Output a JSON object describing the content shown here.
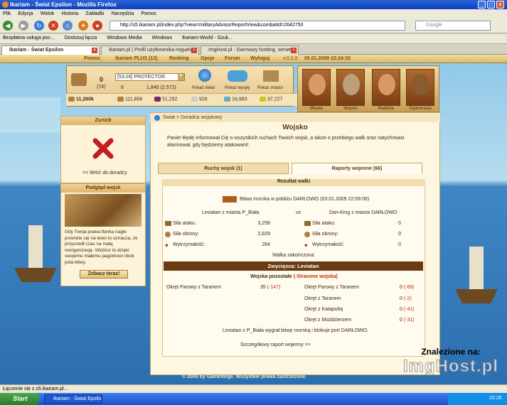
{
  "window": {
    "title": "Ikariam - Świat Epsilon - Mozilla Firefox"
  },
  "menu": [
    "Plik",
    "Edycja",
    "Widok",
    "Historia",
    "Zakładki",
    "Narzędzia",
    "Pomoc"
  ],
  "address": {
    "url": "http://s5.ikariam.pl/index.php?view=militaryAdvisorReportView&combatId=2642750",
    "search_placeholder": "Google"
  },
  "bookmarks": [
    "Bezpłatna usługa poc...",
    "Dostosuj łącza",
    "Windows Media",
    "Windows",
    "Ikariam-World - Szuk..."
  ],
  "tabs": [
    {
      "label": "Ikariam - Świat Epsilon",
      "active": true
    },
    {
      "label": "Ikariam.pl | Profil użytkownika miguela...",
      "active": false
    },
    {
      "label": "ImgHost.pl - Darmowy hosting, serwe...",
      "active": false
    }
  ],
  "game_nav": {
    "items": [
      "Pomoc",
      "Ikariam PLUS (13)",
      "Ranking",
      "Opcje",
      "Forum",
      "Wyloguj"
    ],
    "version": "v.0.2.8",
    "datetime": "05.01.2009 22:24:33"
  },
  "hud": {
    "citizens": "0",
    "citizens_sub": "(74)",
    "gold": "11,260k",
    "city_select": "[53:26] PROTECTOR",
    "actions": "6",
    "income": "1,845 (2,572)",
    "buttons": [
      "Pokaż świat",
      "Pokaż wyspę",
      "Pokaż miasto"
    ]
  },
  "resources": [
    "111,856",
    "51,292",
    "926",
    "16,983",
    "37,227"
  ],
  "advisors": [
    "Miasta",
    "Wojsko",
    "Badania",
    "Dyplomacja"
  ],
  "left_panel": {
    "header": "Zurück",
    "back_link": "<< Wróć do doradcy"
  },
  "troops_panel": {
    "header": "Podgląd wojsk",
    "text": "Gdy Twoja prawa flanka nagle przerwie się na lewo to oznacza, że przyszedł czas na małą reorganizację. Widzisz to dzięki swojemu małemu pagórkowi obok pola bitwy.",
    "button": "Zobacz teraz!"
  },
  "main": {
    "breadcrumb": "Świat > Doradca wojskowy",
    "title": "Wojsko",
    "intro": "Panie! Będę informował Cię o wszystkich ruchach Twoich wojsk, a także o przebiegu walk oraz natychmiast alarmował, gdy będziemy atakowani!",
    "tab_moves": "Ruchy wojsk (1)",
    "tab_reports": "Raporty wojenne (66)",
    "result_header": "Rezultat walki",
    "battle_title": "Bitwa morska w pobliżu DARŁOWO (03.01.2009 22:09:06)",
    "attacker": "Leviatan z miasta P_Biała",
    "vs": "vs",
    "defender": "Dan-King z miasta DARŁOWO",
    "stats": [
      {
        "label": "Siła ataku:",
        "att": "3,256",
        "def": "0"
      },
      {
        "label": "Siła obrony:",
        "att": "2,829",
        "def": "0"
      },
      {
        "label": "Wytrzymałość:",
        "att": "264",
        "def": "0"
      }
    ],
    "battle_status": "Walka zakończona",
    "winner": "Zwycięzca: Leviatan",
    "remaining_header": "Wojska pozostałe",
    "remaining_lost": "(-Stracone wojska)",
    "att_units": [
      {
        "name": "Okręt Parowy z Taranem",
        "count": "35",
        "lost": "(-147)"
      }
    ],
    "def_units": [
      {
        "name": "Okręt Parowy z Taranem",
        "count": "0",
        "lost": "(-69)"
      },
      {
        "name": "Okręt z Taranem",
        "count": "0",
        "lost": "(-2)"
      },
      {
        "name": "Okręt z Katapultą",
        "count": "0",
        "lost": "(-41)"
      },
      {
        "name": "Okręt z Moździerzem",
        "count": "0",
        "lost": "(-31)"
      }
    ],
    "summary": "Leviatan z P_Biała wygrał bitwę morską i blokuje port DARŁOWO.",
    "detail_link": "Szczegółowy raport wojenny >>",
    "footer": "© 2008 by Gameforge. Wszystkie prawa zastrzeżone."
  },
  "statusbar": "Łączenie się z s5.ikariam.pl...",
  "taskbar": {
    "start": "Start",
    "item": "Ikariam - Świat Epsilo...",
    "clock": "22:26"
  },
  "watermark": {
    "line1": "Znalezione na:",
    "line2": "ImgHost.pl"
  },
  "colors": {
    "title_bar": "#0a3fbf",
    "winner_bar": "#6b3c12",
    "lost": "#c03000",
    "parchment": "#fdf6e0"
  }
}
